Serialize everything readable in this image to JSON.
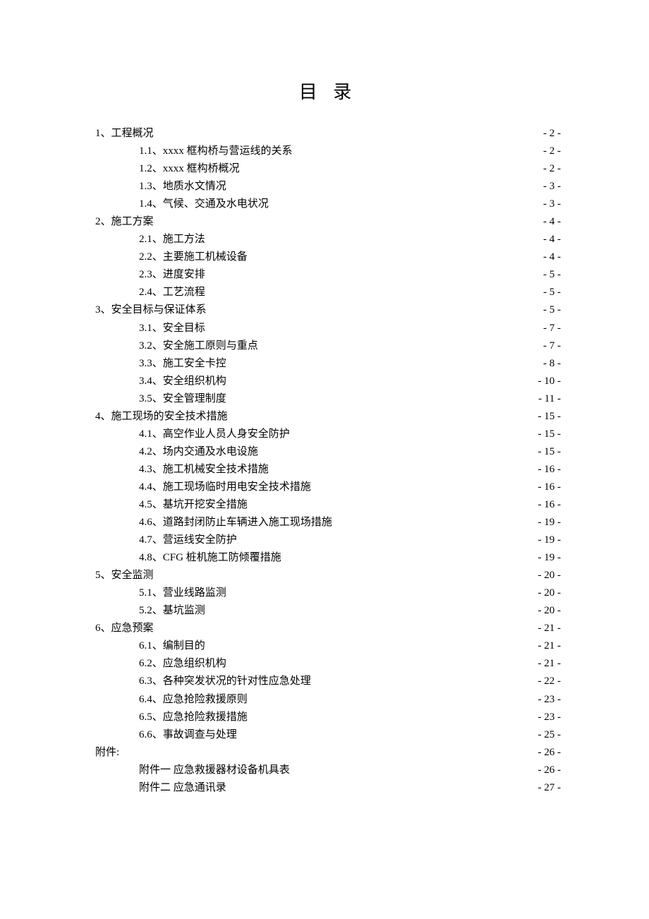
{
  "title": "目 录",
  "entries": [
    {
      "level": 1,
      "label": "1、工程概况",
      "page": "- 2 -"
    },
    {
      "level": 2,
      "label": "1.1、xxxx 框构桥与营运线的关系",
      "page": "- 2 -"
    },
    {
      "level": 2,
      "label": "1.2、xxxx 框构桥概况",
      "page": "- 2 -"
    },
    {
      "level": 2,
      "label": "1.3、地质水文情况",
      "page": "- 3 -"
    },
    {
      "level": 2,
      "label": "1.4、气候、交通及水电状况",
      "page": "- 3 -"
    },
    {
      "level": 1,
      "label": "2、施工方案",
      "page": "- 4 -"
    },
    {
      "level": 2,
      "label": "2.1、施工方法",
      "page": "- 4 -"
    },
    {
      "level": 2,
      "label": "2.2、主要施工机械设备",
      "page": "- 4 -"
    },
    {
      "level": 2,
      "label": "2.3、进度安排",
      "page": "- 5 -"
    },
    {
      "level": 2,
      "label": "2.4、工艺流程",
      "page": "- 5 -"
    },
    {
      "level": 1,
      "label": "3、安全目标与保证体系",
      "page": "- 5 -"
    },
    {
      "level": 2,
      "label": "3.1、安全目标",
      "page": "- 7 -"
    },
    {
      "level": 2,
      "label": "3.2、安全施工原则与重点",
      "page": "- 7 -"
    },
    {
      "level": 2,
      "label": "3.3、施工安全卡控",
      "page": "- 8 -"
    },
    {
      "level": 2,
      "label": "3.4、安全组织机构",
      "page": "- 10 -"
    },
    {
      "level": 2,
      "label": "3.5、安全管理制度",
      "page": "- 11 -"
    },
    {
      "level": 1,
      "label": "4、施工现场的安全技术措施",
      "page": "- 15 -"
    },
    {
      "level": 2,
      "label": "4.1、高空作业人员人身安全防护",
      "page": "- 15 -"
    },
    {
      "level": 2,
      "label": "4.2、场内交通及水电设施",
      "page": "- 15 -"
    },
    {
      "level": 2,
      "label": "4.3、施工机械安全技术措施",
      "page": "- 16 -"
    },
    {
      "level": 2,
      "label": "4.4、施工现场临时用电安全技术措施",
      "page": "- 16 -"
    },
    {
      "level": 2,
      "label": "4.5、基坑开挖安全措施",
      "page": "- 16 -"
    },
    {
      "level": 2,
      "label": "4.6、道路封闭防止车辆进入施工现场措施",
      "page": "- 19 -"
    },
    {
      "level": 2,
      "label": "4.7、营运线安全防护",
      "page": "- 19 -"
    },
    {
      "level": 2,
      "label": "4.8、CFG 桩机施工防倾覆措施",
      "page": "- 19 -"
    },
    {
      "level": 1,
      "label": "5、安全监测",
      "page": "- 20 -"
    },
    {
      "level": 2,
      "label": "5.1、营业线路监测",
      "page": "- 20 -"
    },
    {
      "level": 2,
      "label": "5.2、基坑监测",
      "page": "- 20 -"
    },
    {
      "level": 1,
      "label": "6、应急预案",
      "page": "- 21 -"
    },
    {
      "level": 2,
      "label": "6.1、编制目的",
      "page": "- 21 -"
    },
    {
      "level": 2,
      "label": "6.2、应急组织机构",
      "page": "- 21 -"
    },
    {
      "level": 2,
      "label": "6.3、各种突发状况的针对性应急处理",
      "page": "- 22 -"
    },
    {
      "level": 2,
      "label": "6.4、应急抢险救援原则",
      "page": "- 23 -"
    },
    {
      "level": 2,
      "label": "6.5、应急抢险救援措施",
      "page": "- 23 -"
    },
    {
      "level": 2,
      "label": "6.6、事故调查与处理",
      "page": "- 25 -"
    },
    {
      "level": 1,
      "label": "附件:",
      "page": "- 26 -"
    },
    {
      "level": 2,
      "label": "附件一 应急救援器材设备机具表",
      "page": "- 26 -"
    },
    {
      "level": 2,
      "label": "附件二 应急通讯录",
      "page": "- 27 -"
    }
  ]
}
